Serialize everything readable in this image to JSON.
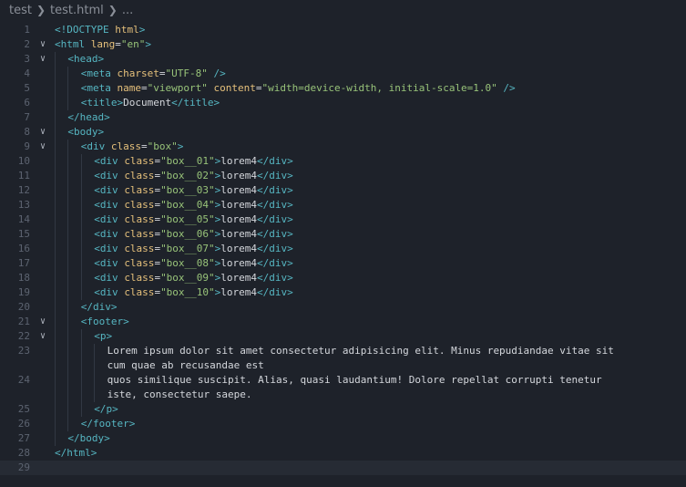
{
  "breadcrumb": {
    "folder": "test",
    "file": "test.html",
    "more": "..."
  },
  "editor": {
    "language": "html",
    "lines": [
      {
        "n": "1",
        "fold": false,
        "indent": 0,
        "parts": [
          [
            "br",
            "<!"
          ],
          [
            "tag",
            "DOCTYPE"
          ],
          [
            "txt",
            " "
          ],
          [
            "attr",
            "html"
          ],
          [
            "br",
            ">"
          ]
        ]
      },
      {
        "n": "2",
        "fold": true,
        "indent": 0,
        "parts": [
          [
            "br",
            "<"
          ],
          [
            "tag",
            "html"
          ],
          [
            "txt",
            " "
          ],
          [
            "attr",
            "lang"
          ],
          [
            "txt",
            "="
          ],
          [
            "str",
            "\"en\""
          ],
          [
            "br",
            ">"
          ]
        ]
      },
      {
        "n": "3",
        "fold": true,
        "indent": 1,
        "parts": [
          [
            "br",
            "<"
          ],
          [
            "tag",
            "head"
          ],
          [
            "br",
            ">"
          ]
        ]
      },
      {
        "n": "4",
        "fold": false,
        "indent": 2,
        "parts": [
          [
            "br",
            "<"
          ],
          [
            "tag",
            "meta"
          ],
          [
            "txt",
            " "
          ],
          [
            "attr",
            "charset"
          ],
          [
            "txt",
            "="
          ],
          [
            "str",
            "\"UTF-8\""
          ],
          [
            "txt",
            " "
          ],
          [
            "br",
            "/>"
          ]
        ]
      },
      {
        "n": "5",
        "fold": false,
        "indent": 2,
        "parts": [
          [
            "br",
            "<"
          ],
          [
            "tag",
            "meta"
          ],
          [
            "txt",
            " "
          ],
          [
            "attr",
            "name"
          ],
          [
            "txt",
            "="
          ],
          [
            "str",
            "\"viewport\""
          ],
          [
            "txt",
            " "
          ],
          [
            "attr",
            "content"
          ],
          [
            "txt",
            "="
          ],
          [
            "str",
            "\"width=device-width, initial-scale=1.0\""
          ],
          [
            "txt",
            " "
          ],
          [
            "br",
            "/>"
          ]
        ]
      },
      {
        "n": "6",
        "fold": false,
        "indent": 2,
        "parts": [
          [
            "br",
            "<"
          ],
          [
            "tag",
            "title"
          ],
          [
            "br",
            ">"
          ],
          [
            "txt",
            "Document"
          ],
          [
            "br",
            "</"
          ],
          [
            "tag",
            "title"
          ],
          [
            "br",
            ">"
          ]
        ]
      },
      {
        "n": "7",
        "fold": false,
        "indent": 1,
        "parts": [
          [
            "br",
            "</"
          ],
          [
            "tag",
            "head"
          ],
          [
            "br",
            ">"
          ]
        ]
      },
      {
        "n": "8",
        "fold": true,
        "indent": 1,
        "parts": [
          [
            "br",
            "<"
          ],
          [
            "tag",
            "body"
          ],
          [
            "br",
            ">"
          ]
        ]
      },
      {
        "n": "9",
        "fold": true,
        "indent": 2,
        "parts": [
          [
            "br",
            "<"
          ],
          [
            "tag",
            "div"
          ],
          [
            "txt",
            " "
          ],
          [
            "attr",
            "class"
          ],
          [
            "txt",
            "="
          ],
          [
            "str",
            "\"box\""
          ],
          [
            "br",
            ">"
          ]
        ]
      },
      {
        "n": "10",
        "fold": false,
        "indent": 3,
        "parts": [
          [
            "br",
            "<"
          ],
          [
            "tag",
            "div"
          ],
          [
            "txt",
            " "
          ],
          [
            "attr",
            "class"
          ],
          [
            "txt",
            "="
          ],
          [
            "str",
            "\"box__01\""
          ],
          [
            "br",
            ">"
          ],
          [
            "txt",
            "lorem4"
          ],
          [
            "br",
            "</"
          ],
          [
            "tag",
            "div"
          ],
          [
            "br",
            ">"
          ]
        ]
      },
      {
        "n": "11",
        "fold": false,
        "indent": 3,
        "parts": [
          [
            "br",
            "<"
          ],
          [
            "tag",
            "div"
          ],
          [
            "txt",
            " "
          ],
          [
            "attr",
            "class"
          ],
          [
            "txt",
            "="
          ],
          [
            "str",
            "\"box__02\""
          ],
          [
            "br",
            ">"
          ],
          [
            "txt",
            "lorem4"
          ],
          [
            "br",
            "</"
          ],
          [
            "tag",
            "div"
          ],
          [
            "br",
            ">"
          ]
        ]
      },
      {
        "n": "12",
        "fold": false,
        "indent": 3,
        "parts": [
          [
            "br",
            "<"
          ],
          [
            "tag",
            "div"
          ],
          [
            "txt",
            " "
          ],
          [
            "attr",
            "class"
          ],
          [
            "txt",
            "="
          ],
          [
            "str",
            "\"box__03\""
          ],
          [
            "br",
            ">"
          ],
          [
            "txt",
            "lorem4"
          ],
          [
            "br",
            "</"
          ],
          [
            "tag",
            "div"
          ],
          [
            "br",
            ">"
          ]
        ]
      },
      {
        "n": "13",
        "fold": false,
        "indent": 3,
        "parts": [
          [
            "br",
            "<"
          ],
          [
            "tag",
            "div"
          ],
          [
            "txt",
            " "
          ],
          [
            "attr",
            "class"
          ],
          [
            "txt",
            "="
          ],
          [
            "str",
            "\"box__04\""
          ],
          [
            "br",
            ">"
          ],
          [
            "txt",
            "lorem4"
          ],
          [
            "br",
            "</"
          ],
          [
            "tag",
            "div"
          ],
          [
            "br",
            ">"
          ]
        ]
      },
      {
        "n": "14",
        "fold": false,
        "indent": 3,
        "parts": [
          [
            "br",
            "<"
          ],
          [
            "tag",
            "div"
          ],
          [
            "txt",
            " "
          ],
          [
            "attr",
            "class"
          ],
          [
            "txt",
            "="
          ],
          [
            "str",
            "\"box__05\""
          ],
          [
            "br",
            ">"
          ],
          [
            "txt",
            "lorem4"
          ],
          [
            "br",
            "</"
          ],
          [
            "tag",
            "div"
          ],
          [
            "br",
            ">"
          ]
        ]
      },
      {
        "n": "15",
        "fold": false,
        "indent": 3,
        "parts": [
          [
            "br",
            "<"
          ],
          [
            "tag",
            "div"
          ],
          [
            "txt",
            " "
          ],
          [
            "attr",
            "class"
          ],
          [
            "txt",
            "="
          ],
          [
            "str",
            "\"box__06\""
          ],
          [
            "br",
            ">"
          ],
          [
            "txt",
            "lorem4"
          ],
          [
            "br",
            "</"
          ],
          [
            "tag",
            "div"
          ],
          [
            "br",
            ">"
          ]
        ]
      },
      {
        "n": "16",
        "fold": false,
        "indent": 3,
        "parts": [
          [
            "br",
            "<"
          ],
          [
            "tag",
            "div"
          ],
          [
            "txt",
            " "
          ],
          [
            "attr",
            "class"
          ],
          [
            "txt",
            "="
          ],
          [
            "str",
            "\"box__07\""
          ],
          [
            "br",
            ">"
          ],
          [
            "txt",
            "lorem4"
          ],
          [
            "br",
            "</"
          ],
          [
            "tag",
            "div"
          ],
          [
            "br",
            ">"
          ]
        ]
      },
      {
        "n": "17",
        "fold": false,
        "indent": 3,
        "parts": [
          [
            "br",
            "<"
          ],
          [
            "tag",
            "div"
          ],
          [
            "txt",
            " "
          ],
          [
            "attr",
            "class"
          ],
          [
            "txt",
            "="
          ],
          [
            "str",
            "\"box__08\""
          ],
          [
            "br",
            ">"
          ],
          [
            "txt",
            "lorem4"
          ],
          [
            "br",
            "</"
          ],
          [
            "tag",
            "div"
          ],
          [
            "br",
            ">"
          ]
        ]
      },
      {
        "n": "18",
        "fold": false,
        "indent": 3,
        "parts": [
          [
            "br",
            "<"
          ],
          [
            "tag",
            "div"
          ],
          [
            "txt",
            " "
          ],
          [
            "attr",
            "class"
          ],
          [
            "txt",
            "="
          ],
          [
            "str",
            "\"box__09\""
          ],
          [
            "br",
            ">"
          ],
          [
            "txt",
            "lorem4"
          ],
          [
            "br",
            "</"
          ],
          [
            "tag",
            "div"
          ],
          [
            "br",
            ">"
          ]
        ]
      },
      {
        "n": "19",
        "fold": false,
        "indent": 3,
        "parts": [
          [
            "br",
            "<"
          ],
          [
            "tag",
            "div"
          ],
          [
            "txt",
            " "
          ],
          [
            "attr",
            "class"
          ],
          [
            "txt",
            "="
          ],
          [
            "str",
            "\"box__10\""
          ],
          [
            "br",
            ">"
          ],
          [
            "txt",
            "lorem4"
          ],
          [
            "br",
            "</"
          ],
          [
            "tag",
            "div"
          ],
          [
            "br",
            ">"
          ]
        ]
      },
      {
        "n": "20",
        "fold": false,
        "indent": 2,
        "parts": [
          [
            "br",
            "</"
          ],
          [
            "tag",
            "div"
          ],
          [
            "br",
            ">"
          ]
        ]
      },
      {
        "n": "21",
        "fold": true,
        "indent": 2,
        "parts": [
          [
            "br",
            "<"
          ],
          [
            "tag",
            "footer"
          ],
          [
            "br",
            ">"
          ]
        ]
      },
      {
        "n": "22",
        "fold": true,
        "indent": 3,
        "parts": [
          [
            "br",
            "<"
          ],
          [
            "tag",
            "p"
          ],
          [
            "br",
            ">"
          ]
        ]
      },
      {
        "n": "23",
        "fold": false,
        "indent": 4,
        "parts": [
          [
            "txt",
            "Lorem ipsum dolor sit amet consectetur adipisicing elit. Minus repudiandae vitae sit"
          ]
        ]
      },
      {
        "n": "",
        "fold": false,
        "indent": 4,
        "parts": [
          [
            "txt",
            "cum quae ab recusandae est"
          ]
        ]
      },
      {
        "n": "24",
        "fold": false,
        "indent": 4,
        "parts": [
          [
            "txt",
            "quos similique suscipit. Alias, quasi laudantium! Dolore repellat corrupti tenetur"
          ]
        ]
      },
      {
        "n": "",
        "fold": false,
        "indent": 4,
        "parts": [
          [
            "txt",
            "iste, consectetur saepe."
          ]
        ]
      },
      {
        "n": "25",
        "fold": false,
        "indent": 3,
        "parts": [
          [
            "br",
            "</"
          ],
          [
            "tag",
            "p"
          ],
          [
            "br",
            ">"
          ]
        ]
      },
      {
        "n": "26",
        "fold": false,
        "indent": 2,
        "parts": [
          [
            "br",
            "</"
          ],
          [
            "tag",
            "footer"
          ],
          [
            "br",
            ">"
          ]
        ]
      },
      {
        "n": "27",
        "fold": false,
        "indent": 1,
        "parts": [
          [
            "br",
            "</"
          ],
          [
            "tag",
            "body"
          ],
          [
            "br",
            ">"
          ]
        ]
      },
      {
        "n": "28",
        "fold": false,
        "indent": 0,
        "parts": [
          [
            "br",
            "</"
          ],
          [
            "tag",
            "html"
          ],
          [
            "br",
            ">"
          ]
        ]
      },
      {
        "n": "29",
        "fold": false,
        "indent": 0,
        "parts": []
      }
    ]
  }
}
